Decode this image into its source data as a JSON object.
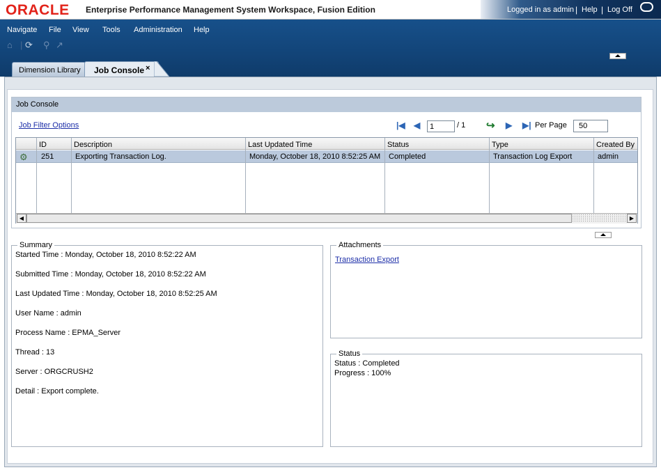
{
  "banner": {
    "logo": "ORACLE",
    "title": "Enterprise Performance Management System Workspace, Fusion Edition",
    "logged_in": "Logged in as admin",
    "help": "Help",
    "logoff": "Log Off",
    "sep": "|"
  },
  "menu": {
    "items": [
      "Navigate",
      "File",
      "View",
      "Tools",
      "Administration",
      "Help"
    ]
  },
  "tabs": [
    {
      "label": "Dimension Library"
    },
    {
      "label": "Job Console",
      "close": "×"
    }
  ],
  "job_console": {
    "title": "Job Console",
    "filter_link": "Job Filter Options",
    "page_current": "1",
    "page_of": "/ 1",
    "per_page_label": "Per Page",
    "per_page_value": "50",
    "columns": [
      "ID",
      "Description",
      "Last Updated Time",
      "Status",
      "Type",
      "Created By"
    ],
    "rows": [
      {
        "id": "251",
        "description": "Exporting Transaction Log.",
        "last_updated": "Monday, October 18, 2010 8:52:25 AM",
        "status": "Completed",
        "type": "Transaction Log Export",
        "created_by": "admin"
      }
    ]
  },
  "summary": {
    "legend": "Summary",
    "lines": [
      "Started Time : Monday, October 18, 2010 8:52:22 AM",
      "Submitted Time : Monday, October 18, 2010 8:52:22 AM",
      "Last Updated Time : Monday, October 18, 2010 8:52:25 AM",
      "User Name : admin",
      "Process Name : EPMA_Server",
      "Thread : 13",
      "Server : ORGCRUSH2",
      "Detail : Export complete."
    ]
  },
  "attachments": {
    "legend": "Attachments",
    "link": "Transaction Export"
  },
  "status_panel": {
    "legend": "Status",
    "status_line": "Status : Completed",
    "progress_line": "Progress : 100%"
  },
  "colors": {
    "header_blue": "#124478",
    "oracle_red": "#e2231a",
    "selected_row": "#bac9dd"
  }
}
